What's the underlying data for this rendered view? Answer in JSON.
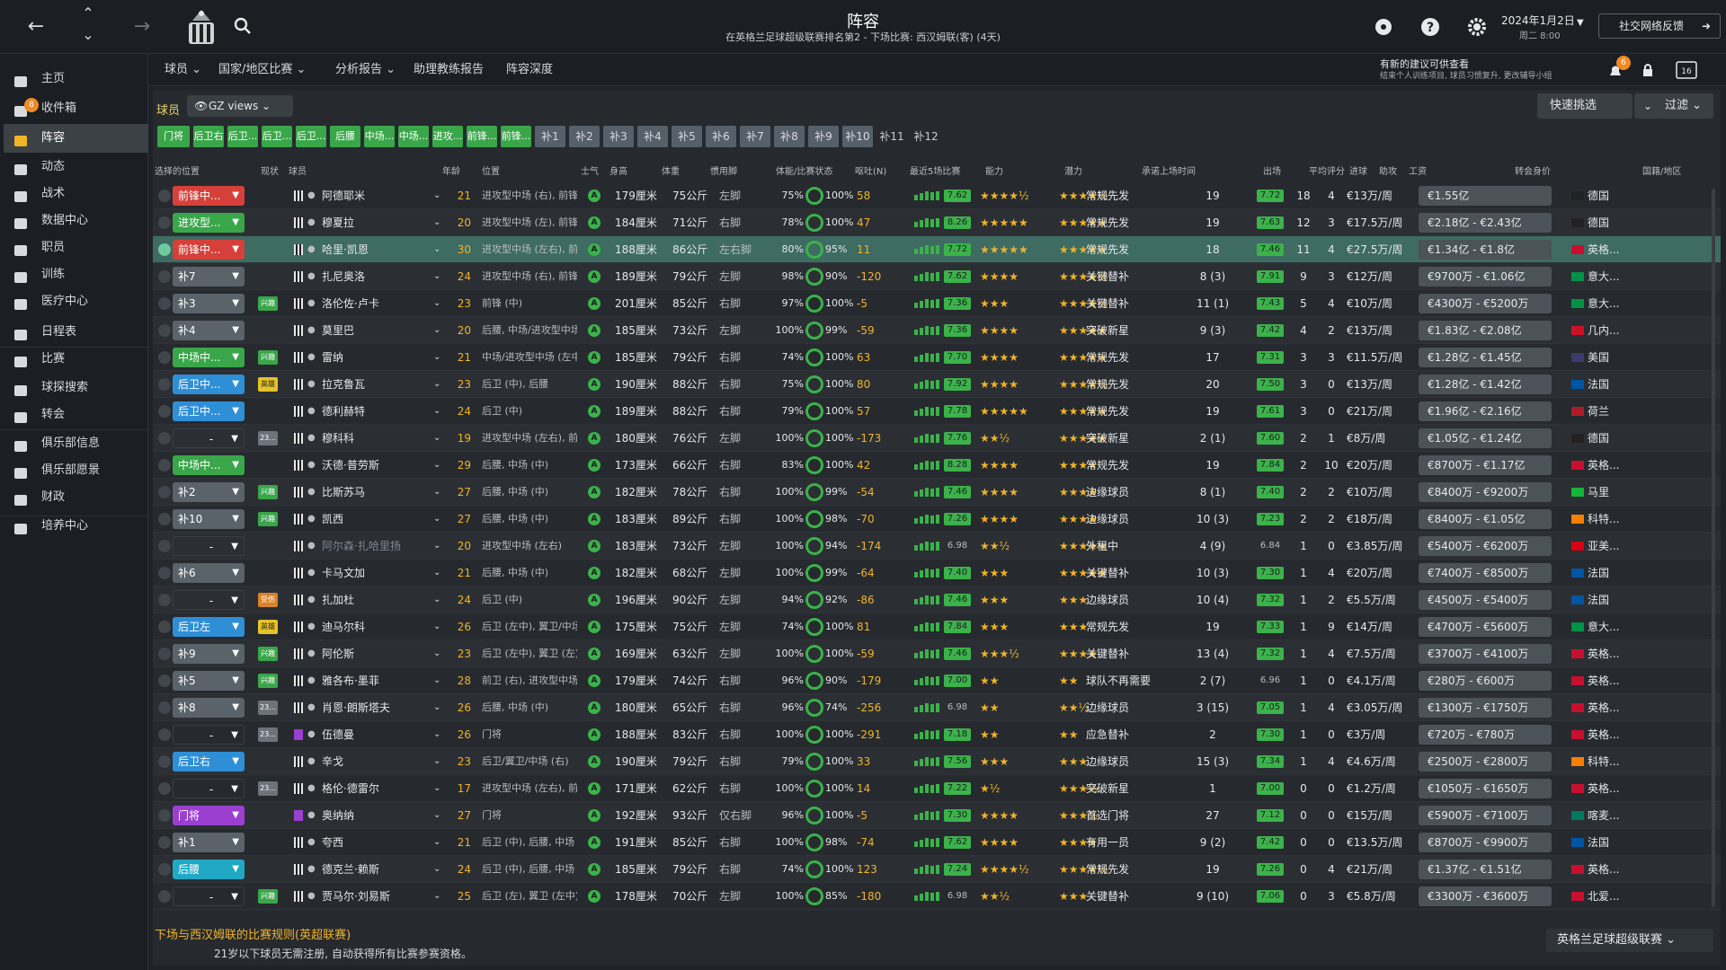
{
  "header": {
    "title": "阵容",
    "subtitle": "在英格兰足球超级联赛排名第2 - 下场比赛: 西汉姆联(客) (4天)",
    "date": "2024年1月2日",
    "weekday": "周二 8:00",
    "social": "社交网络反馈",
    "back": "←",
    "forward": "→",
    "up": "⌃",
    "down": "⌄"
  },
  "notice": {
    "title": "有新的建议可供查看",
    "body": "结束个人训练项目, 球员习惯复升, 更改辅导小组",
    "count": "6"
  },
  "sidebar": {
    "items": [
      {
        "label": "主页",
        "icon": "home-icon"
      },
      {
        "label": "收件箱",
        "icon": "inbox-icon",
        "badge": "8"
      },
      {
        "label": "阵容",
        "icon": "squad-icon"
      },
      {
        "label": "动态",
        "icon": "dynamics-icon"
      },
      {
        "label": "战术",
        "icon": "tactics-icon"
      },
      {
        "label": "数据中心",
        "icon": "data-icon"
      },
      {
        "label": "职员",
        "icon": "staff-icon"
      },
      {
        "label": "训练",
        "icon": "training-icon"
      },
      {
        "label": "医疗中心",
        "icon": "medical-icon"
      },
      {
        "label": "日程表",
        "icon": "calendar-icon"
      },
      {
        "label": "比赛",
        "icon": "trophy-icon"
      },
      {
        "label": "球探搜索",
        "icon": "scouting-icon"
      },
      {
        "label": "转会",
        "icon": "transfer-icon"
      },
      {
        "label": "俱乐部信息",
        "icon": "shield-icon"
      },
      {
        "label": "俱乐部愿景",
        "icon": "vision-icon"
      },
      {
        "label": "财政",
        "icon": "finance-icon"
      },
      {
        "label": "培养中心",
        "icon": "development-icon"
      }
    ]
  },
  "subnav": [
    "球员",
    "国家/地区比赛",
    "分析报告",
    "助理教练报告",
    "阵容深度"
  ],
  "toolbar": {
    "players_label": "球员",
    "view": "GZ views",
    "quick": "快速挑选",
    "filter": "过滤"
  },
  "pos_tabs": [
    "门将",
    "后卫右",
    "后卫...",
    "后卫...",
    "后卫...",
    "后腰",
    "中场...",
    "中场...",
    "进攻...",
    "前锋...",
    "前锋...",
    "补1",
    "补2",
    "补3",
    "补4",
    "补5",
    "补6",
    "补7",
    "补8",
    "补9",
    "补10",
    "补11",
    "补12"
  ],
  "columns": [
    "选择的位置",
    "现状",
    "球员",
    "年龄",
    "位置",
    "士气",
    "身高",
    "体重",
    "惯用脚",
    "体能/比赛状态",
    "呕吐(N)",
    "最近5场比赛",
    "能力",
    "潜力",
    "承诺上场时间",
    "出场",
    "平均评分",
    "进球",
    "助攻",
    "工资",
    "转会身价",
    "国籍/地区"
  ],
  "players": [
    {
      "sel": "前锋中...",
      "selc": "#d6403a",
      "tag": "",
      "name": "阿德耶米",
      "age": "21",
      "pos": "进攻型中场 (右), 前锋 (中)",
      "ht": "179厘米",
      "wt": "75公斤",
      "foot": "左脚",
      "fit": "75%",
      "sharp": "100%",
      "mm": "58",
      "rating": "7.62",
      "ab": "★★★★½",
      "po": "★★★★½",
      "role": "常规先发",
      "apps": "19",
      "avr": "7.72",
      "gls": "18",
      "ast": "4",
      "wage": "€13万/周",
      "val": "€1.55亿",
      "nat": "德国",
      "flag": "#222"
    },
    {
      "sel": "进攻型...",
      "selc": "#3aa64a",
      "tag": "",
      "name": "穆夏拉",
      "age": "20",
      "pos": "进攻型中场 (左), 前锋 (中)",
      "ht": "184厘米",
      "wt": "71公斤",
      "foot": "右脚",
      "fit": "78%",
      "sharp": "100%",
      "mm": "47",
      "rating": "8.26",
      "ab": "★★★★★",
      "po": "★★★★★",
      "role": "常规先发",
      "apps": "19",
      "avr": "7.63",
      "gls": "12",
      "ast": "3",
      "wage": "€17.5万/周",
      "val": "€2.18亿 - €2.43亿",
      "nat": "德国",
      "flag": "#222"
    },
    {
      "sel": "前锋中...",
      "selc": "#d6403a",
      "tag": "",
      "name": "哈里·凯恩",
      "age": "30",
      "pos": "进攻型中场 (左右), 前锋 (中)",
      "ht": "188厘米",
      "wt": "86公斤",
      "foot": "左右脚",
      "fit": "80%",
      "sharp": "95%",
      "mm": "11",
      "rating": "7.72",
      "ab": "★★★★★",
      "po": "★★★★★",
      "role": "常规先发",
      "apps": "18",
      "avr": "7.46",
      "gls": "11",
      "ast": "4",
      "wage": "€27.5万/周",
      "val": "€1.34亿 - €1.8亿",
      "nat": "英格...",
      "flag": "#c8102e",
      "hl": true
    },
    {
      "sel": "补7",
      "selc": "#5a626a",
      "tag": "",
      "name": "扎尼奥洛",
      "age": "24",
      "pos": "进攻型中场 (右), 前锋 (中)",
      "ht": "189厘米",
      "wt": "79公斤",
      "foot": "左脚",
      "fit": "98%",
      "sharp": "90%",
      "mm": "-120",
      "rating": "7.62",
      "ab": "★★★★",
      "po": "★★★★½",
      "role": "关键替补",
      "apps": "8 (3)",
      "avr": "7.91",
      "gls": "9",
      "ast": "3",
      "wage": "€12万/周",
      "val": "€9700万 - €1.06亿",
      "nat": "意大...",
      "flag": "#009246"
    },
    {
      "sel": "补3",
      "selc": "#5a626a",
      "tag": "兴趣",
      "tagc": "#3aa64a",
      "name": "洛伦佐·卢卡",
      "age": "23",
      "pos": "前锋 (中)",
      "ht": "201厘米",
      "wt": "85公斤",
      "foot": "右脚",
      "fit": "97%",
      "sharp": "100%",
      "mm": "-5",
      "rating": "7.36",
      "ab": "★★★",
      "po": "★★★★½",
      "role": "关键替补",
      "apps": "11 (1)",
      "avr": "7.43",
      "gls": "5",
      "ast": "4",
      "wage": "€10万/周",
      "val": "€4300万 - €5200万",
      "nat": "意大...",
      "flag": "#009246"
    },
    {
      "sel": "补4",
      "selc": "#5a626a",
      "tag": "",
      "name": "莫里巴",
      "age": "20",
      "pos": "后腰, 中场/进攻型中场 (中)",
      "ht": "185厘米",
      "wt": "73公斤",
      "foot": "左脚",
      "fit": "100%",
      "sharp": "99%",
      "mm": "-59",
      "rating": "7.36",
      "ab": "★★★★",
      "po": "★★★★★",
      "role": "突破新星",
      "apps": "9 (3)",
      "avr": "7.42",
      "gls": "4",
      "ast": "2",
      "wage": "€13万/周",
      "val": "€1.83亿 - €2.08亿",
      "nat": "几内...",
      "flag": "#ce1126"
    },
    {
      "sel": "中场中...",
      "selc": "#3aa64a",
      "tag": "兴趣",
      "tagc": "#3aa64a",
      "name": "雷纳",
      "age": "21",
      "pos": "中场/进攻型中场 (左中)",
      "ht": "185厘米",
      "wt": "79公斤",
      "foot": "右脚",
      "fit": "74%",
      "sharp": "100%",
      "mm": "63",
      "rating": "7.70",
      "ab": "★★★★",
      "po": "★★★★★",
      "role": "常规先发",
      "apps": "17",
      "avr": "7.31",
      "gls": "3",
      "ast": "3",
      "wage": "€11.5万/周",
      "val": "€1.28亿 - €1.45亿",
      "nat": "美国",
      "flag": "#3c3b6e"
    },
    {
      "sel": "后卫中...",
      "selc": "#2f8fd6",
      "tag": "英雄",
      "tagc": "#e6c22a",
      "name": "拉克鲁瓦",
      "age": "23",
      "pos": "后卫 (中), 后腰",
      "ht": "190厘米",
      "wt": "88公斤",
      "foot": "右脚",
      "fit": "75%",
      "sharp": "100%",
      "mm": "80",
      "rating": "7.92",
      "ab": "★★★★",
      "po": "★★★★½",
      "role": "常规先发",
      "apps": "20",
      "avr": "7.50",
      "gls": "3",
      "ast": "0",
      "wage": "€13万/周",
      "val": "€1.28亿 - €1.42亿",
      "nat": "法国",
      "flag": "#0055a4"
    },
    {
      "sel": "后卫中...",
      "selc": "#2f8fd6",
      "tag": "",
      "name": "德利赫特",
      "age": "24",
      "pos": "后卫 (中)",
      "ht": "189厘米",
      "wt": "88公斤",
      "foot": "右脚",
      "fit": "79%",
      "sharp": "100%",
      "mm": "57",
      "rating": "7.78",
      "ab": "★★★★★",
      "po": "★★★★★",
      "role": "常规先发",
      "apps": "19",
      "avr": "7.61",
      "gls": "3",
      "ast": "0",
      "wage": "€21万/周",
      "val": "€1.96亿 - €2.16亿",
      "nat": "荷兰",
      "flag": "#ae1c28"
    },
    {
      "sel": "-",
      "selc": "transparent",
      "tag": "23...",
      "tagc": "#6c737a",
      "name": "穆科科",
      "age": "19",
      "pos": "进攻型中场 (左右), 前锋 (中)",
      "ht": "180厘米",
      "wt": "76公斤",
      "foot": "左脚",
      "fit": "100%",
      "sharp": "100%",
      "mm": "-173",
      "rating": "7.76",
      "ab": "★★½",
      "po": "★★★★★",
      "role": "突破新星",
      "apps": "2 (1)",
      "avr": "7.60",
      "gls": "2",
      "ast": "1",
      "wage": "€8万/周",
      "val": "€1.05亿 - €1.24亿",
      "nat": "德国",
      "flag": "#222"
    },
    {
      "sel": "中场中...",
      "selc": "#3aa64a",
      "tag": "",
      "name": "沃德·普劳斯",
      "age": "29",
      "pos": "后腰, 中场 (中)",
      "ht": "173厘米",
      "wt": "66公斤",
      "foot": "右脚",
      "fit": "83%",
      "sharp": "100%",
      "mm": "42",
      "rating": "8.28",
      "ab": "★★★★",
      "po": "★★★★",
      "role": "常规先发",
      "apps": "19",
      "avr": "7.84",
      "gls": "2",
      "ast": "10",
      "wage": "€20万/周",
      "val": "€8700万 - €1.17亿",
      "nat": "英格...",
      "flag": "#c8102e"
    },
    {
      "sel": "补2",
      "selc": "#5a626a",
      "tag": "兴趣",
      "tagc": "#3aa64a",
      "name": "比斯苏马",
      "age": "27",
      "pos": "后腰, 中场 (中)",
      "ht": "182厘米",
      "wt": "78公斤",
      "foot": "右脚",
      "fit": "100%",
      "sharp": "99%",
      "mm": "-54",
      "rating": "7.46",
      "ab": "★★★★",
      "po": "★★★★",
      "role": "边缘球员",
      "apps": "8 (1)",
      "avr": "7.40",
      "gls": "2",
      "ast": "2",
      "wage": "€10万/周",
      "val": "€8400万 - €9200万",
      "nat": "马里",
      "flag": "#14b53a"
    },
    {
      "sel": "补10",
      "selc": "#5a626a",
      "tag": "兴趣",
      "tagc": "#3aa64a",
      "name": "凯西",
      "age": "27",
      "pos": "后腰, 中场 (中)",
      "ht": "183厘米",
      "wt": "89公斤",
      "foot": "右脚",
      "fit": "100%",
      "sharp": "98%",
      "mm": "-70",
      "rating": "7.26",
      "ab": "★★★★",
      "po": "★★★★",
      "role": "边缘球员",
      "apps": "10 (3)",
      "avr": "7.23",
      "gls": "2",
      "ast": "2",
      "wage": "€18万/周",
      "val": "€8400万 - €1.05亿",
      "nat": "科特...",
      "flag": "#f77f00"
    },
    {
      "sel": "-",
      "selc": "transparent",
      "tag": "",
      "name": "阿尔森·扎哈里扬",
      "age": "20",
      "pos": "进攻型中场 (左右)",
      "ht": "183厘米",
      "wt": "73公斤",
      "foot": "左脚",
      "fit": "100%",
      "sharp": "94%",
      "mm": "-174",
      "rating": "6.98",
      "ab": "★★½",
      "po": "★★★★★",
      "role": "外租中",
      "apps": "4 (9)",
      "avr": "6.84",
      "gls": "1",
      "ast": "0",
      "wage": "€3.85万/周",
      "val": "€5400万 - €6200万",
      "nat": "亚美...",
      "flag": "#d90012",
      "dim": true
    },
    {
      "sel": "补6",
      "selc": "#5a626a",
      "tag": "",
      "name": "卡马文加",
      "age": "21",
      "pos": "后腰, 中场 (中)",
      "ht": "182厘米",
      "wt": "68公斤",
      "foot": "左脚",
      "fit": "100%",
      "sharp": "99%",
      "mm": "-64",
      "rating": "7.40",
      "ab": "★★★",
      "po": "★★★★★",
      "role": "关键替补",
      "apps": "10 (3)",
      "avr": "7.30",
      "gls": "1",
      "ast": "4",
      "wage": "€20万/周",
      "val": "€7400万 - €8500万",
      "nat": "法国",
      "flag": "#0055a4"
    },
    {
      "sel": "-",
      "selc": "transparent",
      "tag": "受伤",
      "tagc": "#d9822b",
      "name": "扎加杜",
      "age": "24",
      "pos": "后卫 (中)",
      "ht": "196厘米",
      "wt": "90公斤",
      "foot": "左脚",
      "fit": "94%",
      "sharp": "92%",
      "mm": "-86",
      "rating": "7.46",
      "ab": "★★★",
      "po": "★★★",
      "role": "边缘球员",
      "apps": "10 (4)",
      "avr": "7.32",
      "gls": "1",
      "ast": "2",
      "wage": "€5.5万/周",
      "val": "€4500万 - €5400万",
      "nat": "法国",
      "flag": "#0055a4"
    },
    {
      "sel": "后卫左",
      "selc": "#2f8fd6",
      "tag": "英雄",
      "tagc": "#e6c22a",
      "name": "迪马尔科",
      "age": "26",
      "pos": "后卫 (左中), 翼卫/中场 (左)",
      "ht": "175厘米",
      "wt": "75公斤",
      "foot": "左脚",
      "fit": "74%",
      "sharp": "100%",
      "mm": "81",
      "rating": "7.84",
      "ab": "★★★",
      "po": "★★★",
      "role": "常规先发",
      "apps": "19",
      "avr": "7.33",
      "gls": "1",
      "ast": "9",
      "wage": "€14万/周",
      "val": "€4700万 - €5600万",
      "nat": "意大...",
      "flag": "#009246"
    },
    {
      "sel": "补9",
      "selc": "#5a626a",
      "tag": "兴趣",
      "tagc": "#3aa64a",
      "name": "阿伦斯",
      "age": "23",
      "pos": "后卫 (左中), 翼卫 (左)",
      "ht": "169厘米",
      "wt": "63公斤",
      "foot": "左脚",
      "fit": "100%",
      "sharp": "100%",
      "mm": "-59",
      "rating": "7.46",
      "ab": "★★★½",
      "po": "★★★★",
      "role": "关键替补",
      "apps": "13 (4)",
      "avr": "7.32",
      "gls": "1",
      "ast": "4",
      "wage": "€7.5万/周",
      "val": "€3700万 - €4100万",
      "nat": "英格...",
      "flag": "#c8102e"
    },
    {
      "sel": "补5",
      "selc": "#5a626a",
      "tag": "兴趣",
      "tagc": "#3aa64a",
      "name": "雅各布·墨菲",
      "age": "28",
      "pos": "前卫 (右), 进攻型中场 (左右)",
      "ht": "179厘米",
      "wt": "74公斤",
      "foot": "右脚",
      "fit": "96%",
      "sharp": "90%",
      "mm": "-179",
      "rating": "7.00",
      "ab": "★★",
      "po": "★★",
      "role": "球队不再需要",
      "apps": "2 (7)",
      "avr": "6.96",
      "gls": "1",
      "ast": "0",
      "wage": "€4.1万/周",
      "val": "€280万 - €600万",
      "nat": "英格...",
      "flag": "#c8102e"
    },
    {
      "sel": "补8",
      "selc": "#5a626a",
      "tag": "23...",
      "tagc": "#6c737a",
      "name": "肖恩·朗斯塔夫",
      "age": "26",
      "pos": "后腰, 中场 (中)",
      "ht": "180厘米",
      "wt": "65公斤",
      "foot": "右脚",
      "fit": "96%",
      "sharp": "74%",
      "mm": "-256",
      "rating": "6.98",
      "ab": "★★",
      "po": "★★½",
      "role": "边缘球员",
      "apps": "3 (15)",
      "avr": "7.05",
      "gls": "1",
      "ast": "4",
      "wage": "€3.05万/周",
      "val": "€1300万 - €1750万",
      "nat": "英格...",
      "flag": "#c8102e"
    },
    {
      "sel": "-",
      "selc": "transparent",
      "tag": "23...",
      "tagc": "#6c737a",
      "name": "伍德曼",
      "age": "26",
      "pos": "门将",
      "ht": "188厘米",
      "wt": "83公斤",
      "foot": "右脚",
      "fit": "100%",
      "sharp": "100%",
      "mm": "-291",
      "rating": "7.18",
      "ab": "★★",
      "po": "★★",
      "role": "应急替补",
      "apps": "2",
      "avr": "7.30",
      "gls": "1",
      "ast": "0",
      "wage": "€3万/周",
      "val": "€720万 - €780万",
      "nat": "英格...",
      "flag": "#c8102e",
      "gk": true
    },
    {
      "sel": "后卫右",
      "selc": "#2f8fd6",
      "tag": "",
      "name": "辛戈",
      "age": "23",
      "pos": "后卫/翼卫/中场 (右)",
      "ht": "190厘米",
      "wt": "79公斤",
      "foot": "右脚",
      "fit": "79%",
      "sharp": "100%",
      "mm": "33",
      "rating": "7.56",
      "ab": "★★★",
      "po": "★★★",
      "role": "边缘球员",
      "apps": "15 (3)",
      "avr": "7.34",
      "gls": "1",
      "ast": "4",
      "wage": "€4.6万/周",
      "val": "€2500万 - €2800万",
      "nat": "科特...",
      "flag": "#f77f00"
    },
    {
      "sel": "-",
      "selc": "transparent",
      "tag": "23...",
      "tagc": "#6c737a",
      "name": "格伦·德雷尔",
      "age": "17",
      "pos": "进攻型中场 (左右), 前锋 (中)",
      "ht": "171厘米",
      "wt": "62公斤",
      "foot": "右脚",
      "fit": "100%",
      "sharp": "100%",
      "mm": "14",
      "rating": "7.22",
      "ab": "★½",
      "po": "★★★½",
      "role": "突破新星",
      "apps": "1",
      "avr": "7.00",
      "gls": "0",
      "ast": "0",
      "wage": "€1.2万/周",
      "val": "€1050万 - €1650万",
      "nat": "英格...",
      "flag": "#c8102e"
    },
    {
      "sel": "门将",
      "selc": "#9b3fd0",
      "tag": "",
      "name": "奥纳纳",
      "age": "27",
      "pos": "门将",
      "ht": "192厘米",
      "wt": "93公斤",
      "foot": "仅右脚",
      "fit": "96%",
      "sharp": "100%",
      "mm": "-5",
      "rating": "7.30",
      "ab": "★★★★",
      "po": "★★★½",
      "role": "首选门将",
      "apps": "27",
      "avr": "7.12",
      "gls": "0",
      "ast": "0",
      "wage": "€15万/周",
      "val": "€5900万 - €7100万",
      "nat": "喀麦...",
      "flag": "#007a5e",
      "gk": true
    },
    {
      "sel": "补1",
      "selc": "#5a626a",
      "tag": "",
      "name": "夸西",
      "age": "21",
      "pos": "后卫 (中), 后腰, 中场 (中)",
      "ht": "191厘米",
      "wt": "85公斤",
      "foot": "右脚",
      "fit": "100%",
      "sharp": "98%",
      "mm": "-74",
      "rating": "7.62",
      "ab": "★★★★",
      "po": "★★★★",
      "role": "有用一员",
      "apps": "9 (2)",
      "avr": "7.42",
      "gls": "0",
      "ast": "0",
      "wage": "€13.5万/周",
      "val": "€8700万 - €9900万",
      "nat": "法国",
      "flag": "#0055a4"
    },
    {
      "sel": "后腰",
      "selc": "#20a8c4",
      "tag": "",
      "name": "德克兰·赖斯",
      "age": "24",
      "pos": "后卫 (中), 后腰, 中场 (中)",
      "ht": "185厘米",
      "wt": "79公斤",
      "foot": "右脚",
      "fit": "74%",
      "sharp": "100%",
      "mm": "123",
      "rating": "7.24",
      "ab": "★★★★½",
      "po": "★★★★½",
      "role": "常规先发",
      "apps": "19",
      "avr": "7.26",
      "gls": "0",
      "ast": "4",
      "wage": "€21万/周",
      "val": "€1.37亿 - €1.51亿",
      "nat": "英格...",
      "flag": "#c8102e"
    },
    {
      "sel": "-",
      "selc": "transparent",
      "tag": "兴趣",
      "tagc": "#3aa64a",
      "name": "贾马尔·刘易斯",
      "age": "25",
      "pos": "后卫 (左), 翼卫 (左中)",
      "ht": "178厘米",
      "wt": "70公斤",
      "foot": "左脚",
      "fit": "100%",
      "sharp": "85%",
      "mm": "-180",
      "rating": "6.98",
      "ab": "★★½",
      "po": "★★★",
      "role": "关键替补",
      "apps": "9 (10)",
      "avr": "7.06",
      "gls": "0",
      "ast": "3",
      "wage": "€5.8万/周",
      "val": "€3300万 - €3600万",
      "nat": "北爱...",
      "flag": "#c8102e"
    }
  ],
  "footer": {
    "rule": "下场与西汉姆联的比赛规则(英超联赛)",
    "text": "21岁以下球员无需注册, 自动获得所有比赛参赛资格。",
    "league": "英格兰足球超级联赛"
  },
  "colors": {
    "accent": "#3aa64a",
    "gold": "#f0b429",
    "highlight": "#3e6b62"
  }
}
